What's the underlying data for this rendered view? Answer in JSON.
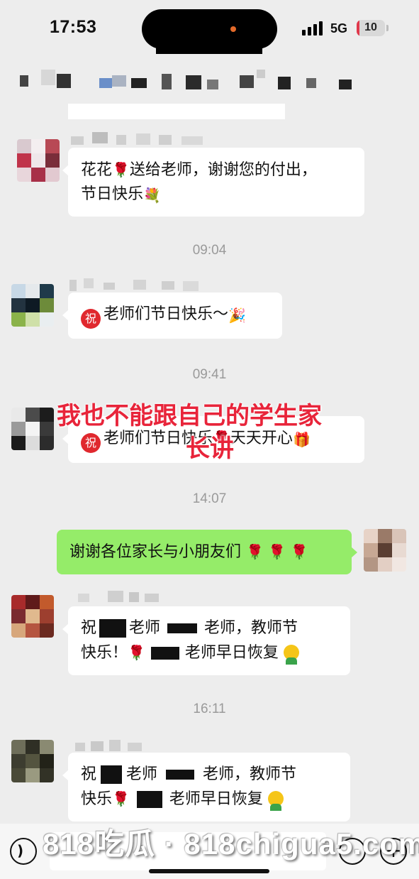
{
  "status_bar": {
    "time": "17:53",
    "network": "5G",
    "battery": "10",
    "battery_level": 0.1
  },
  "messages": [
    {
      "id": "m1",
      "parts": [
        "花花",
        "🌹",
        "送给老师，谢谢您的付出，",
        "节日快乐",
        "💐"
      ]
    },
    {
      "id": "ts1",
      "time": "09:04"
    },
    {
      "id": "m2",
      "badge": "祝",
      "text": "老师们节日快乐～",
      "emoji": "🎉"
    },
    {
      "id": "ts2",
      "time": "09:41"
    },
    {
      "id": "m3",
      "badge": "祝",
      "text_a": "老师们节日快乐",
      "emoji_a": "🌹",
      "text_b": "天天开心",
      "emoji_b": "🎁"
    },
    {
      "id": "ts3",
      "time": "14:07"
    },
    {
      "id": "m4",
      "text": "谢谢各位家长与小朋友们",
      "emoji": "🌹 🌹 🌹"
    },
    {
      "id": "m5",
      "l1_a": "祝",
      "l1_b": "老师",
      "l1_c": "老师，教师节",
      "l2_a": "快乐！",
      "l2_b": "老师早日恢复"
    },
    {
      "id": "ts4",
      "time": "16:11"
    },
    {
      "id": "m6",
      "l1_a": "祝",
      "l1_b": "老师",
      "l1_c": "老师，教师节",
      "l2_a": "快乐",
      "l2_b": "老师早日恢复"
    }
  ],
  "overlay": {
    "line1": "我也不能跟自己的学生家",
    "line2": "长讲"
  },
  "watermark": "818吃瓜 · 818chigua5.com",
  "colors": {
    "background": "#ededed",
    "my_bubble": "#95ec69",
    "other_bubble": "#ffffff",
    "overlay_text": "#e8243a"
  },
  "icons": [
    "voice-icon",
    "emoji-icon",
    "plus-icon",
    "rose-emoji",
    "bouquet-emoji",
    "party-emoji",
    "gift-emoji"
  ]
}
